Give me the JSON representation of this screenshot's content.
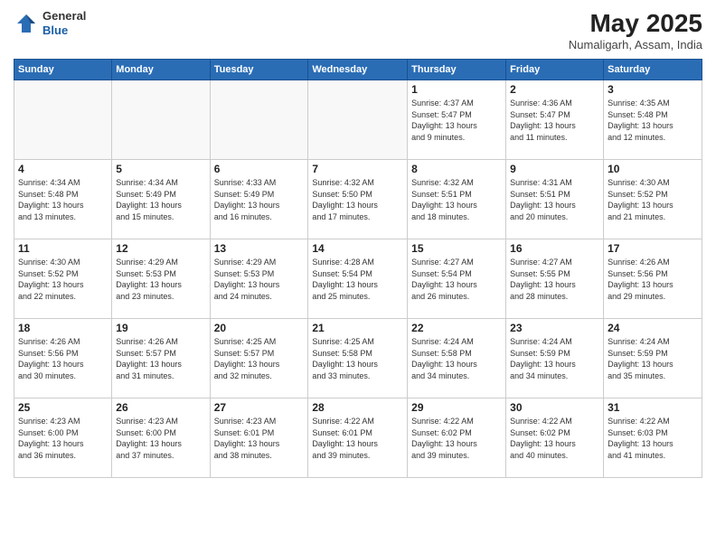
{
  "header": {
    "logo_line1": "General",
    "logo_line2": "Blue",
    "month": "May 2025",
    "location": "Numaligarh, Assam, India"
  },
  "weekdays": [
    "Sunday",
    "Monday",
    "Tuesday",
    "Wednesday",
    "Thursday",
    "Friday",
    "Saturday"
  ],
  "weeks": [
    [
      {
        "day": "",
        "info": ""
      },
      {
        "day": "",
        "info": ""
      },
      {
        "day": "",
        "info": ""
      },
      {
        "day": "",
        "info": ""
      },
      {
        "day": "1",
        "info": "Sunrise: 4:37 AM\nSunset: 5:47 PM\nDaylight: 13 hours\nand 9 minutes."
      },
      {
        "day": "2",
        "info": "Sunrise: 4:36 AM\nSunset: 5:47 PM\nDaylight: 13 hours\nand 11 minutes."
      },
      {
        "day": "3",
        "info": "Sunrise: 4:35 AM\nSunset: 5:48 PM\nDaylight: 13 hours\nand 12 minutes."
      }
    ],
    [
      {
        "day": "4",
        "info": "Sunrise: 4:34 AM\nSunset: 5:48 PM\nDaylight: 13 hours\nand 13 minutes."
      },
      {
        "day": "5",
        "info": "Sunrise: 4:34 AM\nSunset: 5:49 PM\nDaylight: 13 hours\nand 15 minutes."
      },
      {
        "day": "6",
        "info": "Sunrise: 4:33 AM\nSunset: 5:49 PM\nDaylight: 13 hours\nand 16 minutes."
      },
      {
        "day": "7",
        "info": "Sunrise: 4:32 AM\nSunset: 5:50 PM\nDaylight: 13 hours\nand 17 minutes."
      },
      {
        "day": "8",
        "info": "Sunrise: 4:32 AM\nSunset: 5:51 PM\nDaylight: 13 hours\nand 18 minutes."
      },
      {
        "day": "9",
        "info": "Sunrise: 4:31 AM\nSunset: 5:51 PM\nDaylight: 13 hours\nand 20 minutes."
      },
      {
        "day": "10",
        "info": "Sunrise: 4:30 AM\nSunset: 5:52 PM\nDaylight: 13 hours\nand 21 minutes."
      }
    ],
    [
      {
        "day": "11",
        "info": "Sunrise: 4:30 AM\nSunset: 5:52 PM\nDaylight: 13 hours\nand 22 minutes."
      },
      {
        "day": "12",
        "info": "Sunrise: 4:29 AM\nSunset: 5:53 PM\nDaylight: 13 hours\nand 23 minutes."
      },
      {
        "day": "13",
        "info": "Sunrise: 4:29 AM\nSunset: 5:53 PM\nDaylight: 13 hours\nand 24 minutes."
      },
      {
        "day": "14",
        "info": "Sunrise: 4:28 AM\nSunset: 5:54 PM\nDaylight: 13 hours\nand 25 minutes."
      },
      {
        "day": "15",
        "info": "Sunrise: 4:27 AM\nSunset: 5:54 PM\nDaylight: 13 hours\nand 26 minutes."
      },
      {
        "day": "16",
        "info": "Sunrise: 4:27 AM\nSunset: 5:55 PM\nDaylight: 13 hours\nand 28 minutes."
      },
      {
        "day": "17",
        "info": "Sunrise: 4:26 AM\nSunset: 5:56 PM\nDaylight: 13 hours\nand 29 minutes."
      }
    ],
    [
      {
        "day": "18",
        "info": "Sunrise: 4:26 AM\nSunset: 5:56 PM\nDaylight: 13 hours\nand 30 minutes."
      },
      {
        "day": "19",
        "info": "Sunrise: 4:26 AM\nSunset: 5:57 PM\nDaylight: 13 hours\nand 31 minutes."
      },
      {
        "day": "20",
        "info": "Sunrise: 4:25 AM\nSunset: 5:57 PM\nDaylight: 13 hours\nand 32 minutes."
      },
      {
        "day": "21",
        "info": "Sunrise: 4:25 AM\nSunset: 5:58 PM\nDaylight: 13 hours\nand 33 minutes."
      },
      {
        "day": "22",
        "info": "Sunrise: 4:24 AM\nSunset: 5:58 PM\nDaylight: 13 hours\nand 34 minutes."
      },
      {
        "day": "23",
        "info": "Sunrise: 4:24 AM\nSunset: 5:59 PM\nDaylight: 13 hours\nand 34 minutes."
      },
      {
        "day": "24",
        "info": "Sunrise: 4:24 AM\nSunset: 5:59 PM\nDaylight: 13 hours\nand 35 minutes."
      }
    ],
    [
      {
        "day": "25",
        "info": "Sunrise: 4:23 AM\nSunset: 6:00 PM\nDaylight: 13 hours\nand 36 minutes."
      },
      {
        "day": "26",
        "info": "Sunrise: 4:23 AM\nSunset: 6:00 PM\nDaylight: 13 hours\nand 37 minutes."
      },
      {
        "day": "27",
        "info": "Sunrise: 4:23 AM\nSunset: 6:01 PM\nDaylight: 13 hours\nand 38 minutes."
      },
      {
        "day": "28",
        "info": "Sunrise: 4:22 AM\nSunset: 6:01 PM\nDaylight: 13 hours\nand 39 minutes."
      },
      {
        "day": "29",
        "info": "Sunrise: 4:22 AM\nSunset: 6:02 PM\nDaylight: 13 hours\nand 39 minutes."
      },
      {
        "day": "30",
        "info": "Sunrise: 4:22 AM\nSunset: 6:02 PM\nDaylight: 13 hours\nand 40 minutes."
      },
      {
        "day": "31",
        "info": "Sunrise: 4:22 AM\nSunset: 6:03 PM\nDaylight: 13 hours\nand 41 minutes."
      }
    ]
  ]
}
